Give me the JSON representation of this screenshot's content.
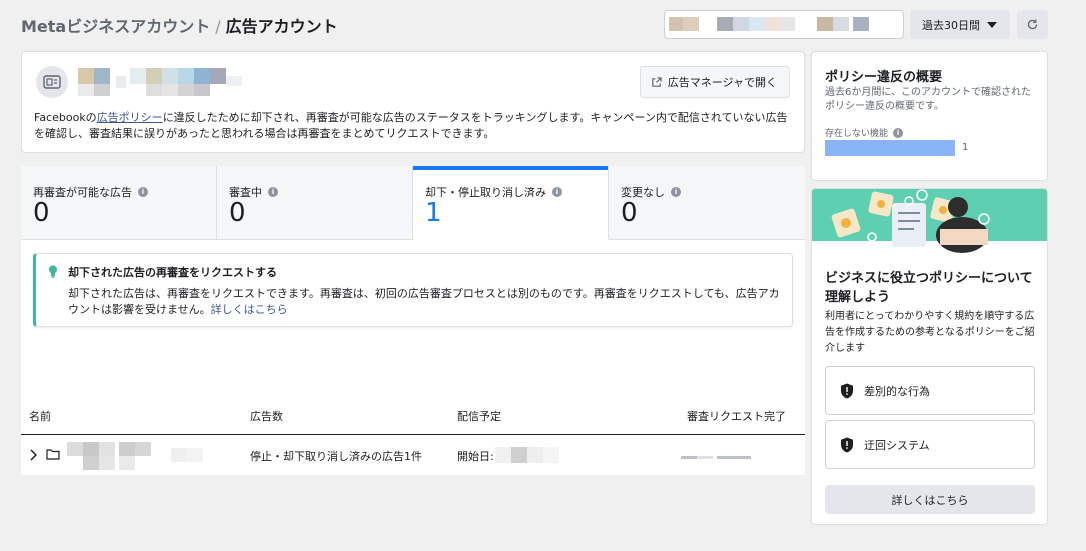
{
  "breadcrumb": {
    "root": "Metaビジネスアカウント",
    "separator": "/",
    "current": "広告アカウント"
  },
  "toolbar": {
    "date_range_label": "過去30日間"
  },
  "account_card": {
    "open_manager_label": "広告マネージャで開く",
    "description_prefix": "Facebookの",
    "description_link": "広告ポリシー",
    "description_suffix": "に違反したために却下され、再審査が可能な広告のステータスをトラッキングします。キャンペーン内で配信されていない広告を確認し、審査結果に誤りがあったと思われる場合は再審査をまとめてリクエストできます。"
  },
  "tabs": [
    {
      "label": "再審査が可能な広告",
      "count": "0"
    },
    {
      "label": "審査中",
      "count": "0"
    },
    {
      "label": "却下・停止取り消し済み",
      "count": "1"
    },
    {
      "label": "変更なし",
      "count": "0"
    }
  ],
  "notice": {
    "title": "却下された広告の再審査をリクエストする",
    "body": "却下された広告は、再審査をリクエストできます。再審査は、初回の広告審査プロセスとは別のものです。再審査をリクエストしても、広告アカウントは影響を受けません。",
    "link": "詳しくはこちら"
  },
  "table": {
    "columns": [
      "名前",
      "広告数",
      "配信予定",
      "審査リクエスト完了"
    ],
    "rows": [
      {
        "ad_count": "停止・却下取り消し済みの広告1件",
        "schedule_prefix": "開始日:"
      }
    ]
  },
  "policy_summary": {
    "title": "ポリシー違反の概要",
    "subtitle": "過去6か月間に、このアカウントで確認されたポリシー違反の概要です。",
    "metric_label": "存在しない機能",
    "metric_value": "1"
  },
  "policy_promo": {
    "title": "ビジネスに役立つポリシーについて理解しよう",
    "subtitle": "利用者にとってわかりやすく規約を順守する広告を作成するための参考となるポリシーをご紹介します",
    "items": [
      {
        "label": "差別的な行為",
        "icon": "shield-icon"
      },
      {
        "label": "迂回システム",
        "icon": "shield-icon"
      }
    ],
    "learn_more_label": "詳しくはこちら"
  },
  "colors": {
    "accent": "#1877f2",
    "notice_border": "#42b7a0",
    "metric_bar": "#8ab4f8",
    "promo_bg": "#5ecfb1"
  }
}
